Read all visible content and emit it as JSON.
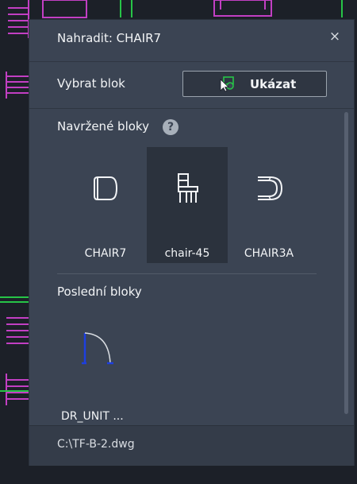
{
  "palette": {
    "title": "Nahradit: CHAIR7",
    "close_label": "×",
    "select_block_label": "Vybrat blok",
    "show_button_label": "Ukázat",
    "suggested_label": "Navržené bloky",
    "help_label": "?",
    "suggested_blocks": [
      {
        "name": "CHAIR7",
        "icon": "chair7-block-icon",
        "selected": false
      },
      {
        "name": "chair-45",
        "icon": "chair-45-block-icon",
        "selected": true
      },
      {
        "name": "CHAIR3A",
        "icon": "chair3a-block-icon",
        "selected": false
      }
    ],
    "recent_label": "Poslední bloky",
    "recent_blocks": [
      {
        "name": "DR_UNIT ...",
        "icon": "door-unit-block-icon"
      }
    ],
    "file_path": "C:\\TF-B-2.dwg"
  },
  "colors": {
    "panel": "#3b4453",
    "cad_background": "#1c2028",
    "cad_magenta": "#c23fc3",
    "cad_green": "#27c447",
    "door_blue": "#1d3fe0"
  }
}
